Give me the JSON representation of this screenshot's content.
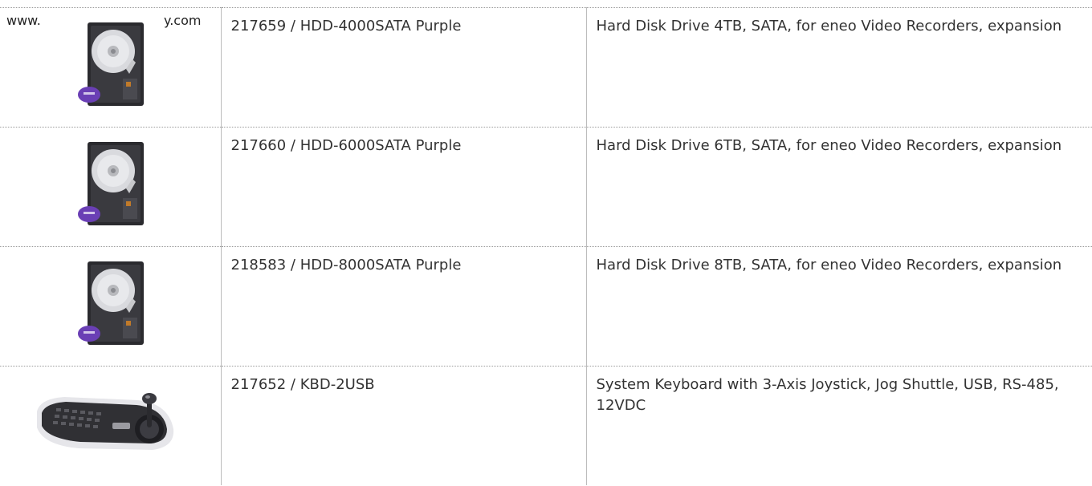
{
  "watermark": {
    "left_text": "www.",
    "right_text": "y.com"
  },
  "products": [
    {
      "image_icon": "hard-disk-drive-icon",
      "number": "217659 / HDD-4000SATA Purple",
      "description": "Hard Disk Drive 4TB, SATA, for eneo Video Recorders, expansion"
    },
    {
      "image_icon": "hard-disk-drive-icon",
      "number": "217660 / HDD-6000SATA Purple",
      "description": "Hard Disk Drive 6TB, SATA, for eneo Video Recorders, expansion"
    },
    {
      "image_icon": "hard-disk-drive-icon",
      "number": "218583 / HDD-8000SATA Purple",
      "description": "Hard Disk Drive 8TB, SATA, for eneo Video Recorders, expansion"
    },
    {
      "image_icon": "system-keyboard-icon",
      "number": "217652 / KBD-2USB",
      "description": "System Keyboard with 3-Axis Joystick, Jog Shuttle, USB, RS-485, 12VDC"
    }
  ],
  "colors": {
    "hdd_body": "#2a2a2e",
    "hdd_platter": "#d9dade",
    "hdd_label": "#6a3fb5",
    "keyboard_body": "#303034",
    "keyboard_rim": "#e6e6ea"
  }
}
